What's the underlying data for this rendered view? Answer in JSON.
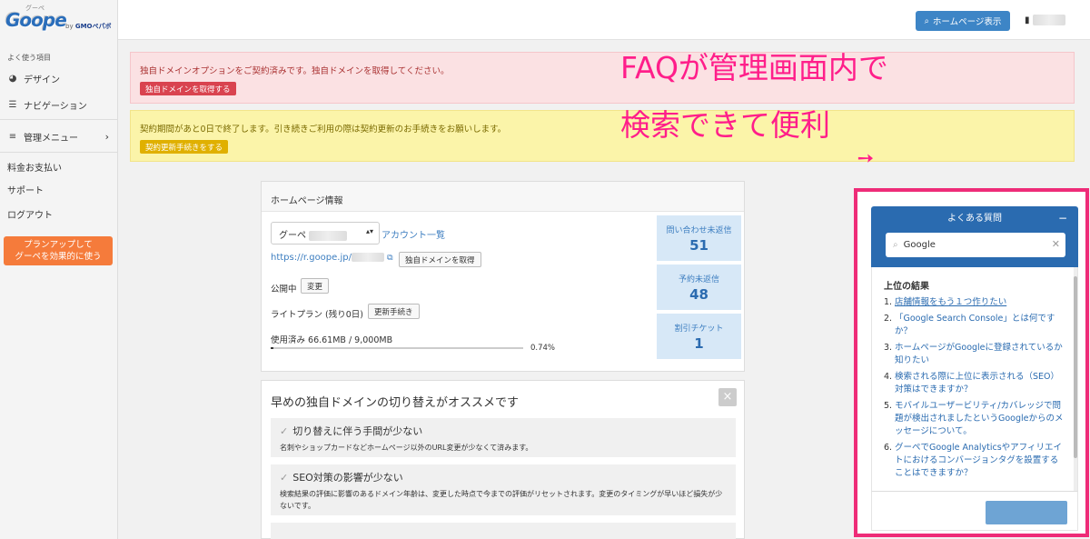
{
  "logo": {
    "main": "Goope",
    "ruby": "グーペ",
    "by": "by",
    "brand": "GMOペパボ"
  },
  "sidebar": {
    "section_label": "よく使う項目",
    "items": [
      {
        "label": "デザイン",
        "icon": "palette-icon"
      },
      {
        "label": "ナビゲーション",
        "icon": "list-icon"
      },
      {
        "label": "管理メニュー",
        "icon": "menu-icon"
      },
      {
        "label": "料金お支払い"
      },
      {
        "label": "サポート"
      },
      {
        "label": "ログアウト"
      }
    ],
    "plan_button": {
      "line1": "プランアップして",
      "line2": "グーペを効果的に使う"
    }
  },
  "topbar": {
    "homepage_button": "ホームページ表示"
  },
  "alerts": {
    "red": {
      "text": "独自ドメインオプションをご契約済みです。独自ドメインを取得してください。",
      "button": "独自ドメインを取得する"
    },
    "yellow": {
      "text": "契約期間があと0日で終了します。引き続きご利用の際は契約更新のお手続きをお願いします。",
      "button": "契約更新手続きをする"
    }
  },
  "overlay": {
    "line1": "FAQが管理画面内で",
    "line2": "検索できて便利"
  },
  "hp_info": {
    "title": "ホームページ情報",
    "site_select": "グーペ",
    "account_link": "アカウント一覧",
    "url": "https://r.goope.jp/",
    "domain_button": "独自ドメインを取得",
    "status": "公開中",
    "change_button": "変更",
    "plan": "ライトプラン (残り0日)",
    "renew_button": "更新手続き",
    "usage": "使用済み 66.61MB / 9,000MB",
    "usage_pct": "0.74%",
    "usage_fraction": 0.0074,
    "stats": [
      {
        "label": "問い合わせ未返信",
        "value": "51"
      },
      {
        "label": "予約未返信",
        "value": "48"
      },
      {
        "label": "割引チケット",
        "value": "1"
      }
    ]
  },
  "domain_panel": {
    "title": "早めの独自ドメインの切り替えがオススメです",
    "close": "×",
    "check": "✓",
    "items": [
      {
        "title": "切り替えに伴う手間が少ない",
        "desc": "名刺やショップカードなどホームページ以外のURL変更が少なくて済みます。"
      },
      {
        "title": "SEO対策の影響が少ない",
        "desc": "検索結果の評価に影響のあるドメイン年齢は、変更した時点で今までの評価がリセットされます。変更のタイミングが早いほど損失が少ないです。"
      }
    ]
  },
  "faq": {
    "title": "よくある質問",
    "minimize": "−",
    "search_value": "Google",
    "results_title": "上位の結果",
    "results": [
      {
        "n": "1.",
        "q": "店舗情報をもう１つ作りたい"
      },
      {
        "n": "2.",
        "q": "「Google Search Console」とは何ですか？"
      },
      {
        "n": "3.",
        "q": "ホームページがGoogleに登録されているか知りたい"
      },
      {
        "n": "4.",
        "q": "検索される際に上位に表示される（SEO）対策はできますか？"
      },
      {
        "n": "5.",
        "q": "モバイルユーザービリティ/カバレッジで問題が検出されましたというGoogleからのメッセージについて。"
      },
      {
        "n": "6.",
        "q": "グーペでGoogle Analyticsやアフィリエイトにおけるコンバージョンタグを設置することはできますか？"
      }
    ]
  },
  "colors": {
    "accent": "#3d85c6",
    "highlight": "#ff1e8a",
    "alert_red": "#d9434f",
    "alert_yellow": "#e0b000",
    "plan_orange": "#f57b3b"
  }
}
